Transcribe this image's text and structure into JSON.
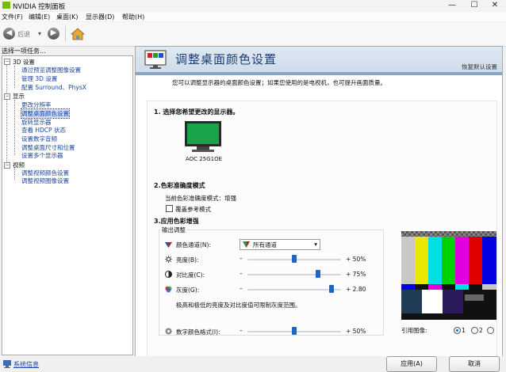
{
  "window": {
    "title": "NVIDIA 控制面板",
    "minimize": "—",
    "maximize": "☐",
    "close": "✕"
  },
  "menu": [
    "文件(F)",
    "编辑(E)",
    "桌面(K)",
    "显示器(D)",
    "帮助(H)"
  ],
  "toolbar": {
    "back_label": "后退",
    "back_arrow": "◀",
    "forward_arrow": "▶",
    "dropdown_glyph": "▾"
  },
  "sidebar": {
    "heading": "选择一项任务...",
    "tree": [
      {
        "label": "3D 设置",
        "kind": "category"
      },
      {
        "label": "通过预览调整图像设置",
        "kind": "link"
      },
      {
        "label": "管理 3D 设置",
        "kind": "link"
      },
      {
        "label": "配置 Surround、PhysX",
        "kind": "link"
      },
      {
        "label": "显示",
        "kind": "category"
      },
      {
        "label": "更改分辨率",
        "kind": "link"
      },
      {
        "label": "调整桌面颜色设置",
        "kind": "selected"
      },
      {
        "label": "旋转显示器",
        "kind": "link"
      },
      {
        "label": "查看 HDCP 状态",
        "kind": "link"
      },
      {
        "label": "设置数字音频",
        "kind": "link"
      },
      {
        "label": "调整桌面尺寸和位置",
        "kind": "link"
      },
      {
        "label": "设置多个显示器",
        "kind": "link"
      },
      {
        "label": "视频",
        "kind": "category"
      },
      {
        "label": "调整视频颜色设置",
        "kind": "link"
      },
      {
        "label": "调整视频图像设置",
        "kind": "link"
      }
    ],
    "expander": "−"
  },
  "page": {
    "title": "调整桌面颜色设置",
    "restore_defaults": "恢复默认设置",
    "description": "您可以调整显示器的桌面颜色设置；如果您使用的是电视机，也可提升画面质量。",
    "step1": "1. 选择您希望更改的显示器。",
    "monitor_name": "AOC 25G1OE",
    "step2": "2.色彩准确度模式",
    "current_mode": "当前色彩准确度模式：增强",
    "override_reference": "覆盖参考模式",
    "step3": "3.应用色彩增强",
    "output_adjust": "输出调整",
    "channel_label": "颜色通道(N):",
    "channel_value": "所有通道",
    "brightness": {
      "label": "亮度(B):",
      "value": "+ 50%",
      "level": 0.5
    },
    "contrast": {
      "label": "对比度(C):",
      "value": "+ 75%",
      "level": 0.75
    },
    "gamma": {
      "label": "灰度(G):",
      "value": "+ 2.80",
      "level": 0.9
    },
    "minus": "–",
    "note": "极高和极低的亮度及对比度值可限制灰度范围。",
    "vibrance": {
      "label": "数字颜色格式(I):",
      "value": "+ 50%",
      "level": 0.5
    },
    "ref_image_label": "引用图像:",
    "ref_options": [
      "1",
      "2",
      "3"
    ]
  },
  "footer": {
    "system_info": "系统信息",
    "apply": "应用(A)",
    "cancel": "取消"
  },
  "colors": {
    "accent_blue": "#1f66c6",
    "nvidia_green": "#76b900",
    "link_blue": "#1a44a6"
  }
}
